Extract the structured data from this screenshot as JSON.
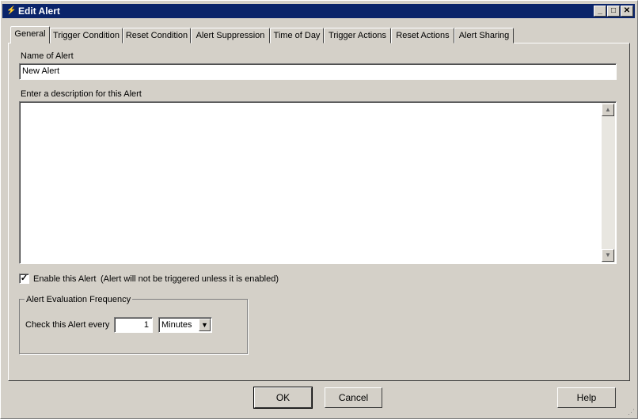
{
  "window": {
    "title": "Edit Alert",
    "controls": [
      "minimize",
      "maximize",
      "close"
    ]
  },
  "tabs": [
    {
      "label": "General",
      "active": true
    },
    {
      "label": "Trigger Condition"
    },
    {
      "label": "Reset Condition"
    },
    {
      "label": "Alert Suppression"
    },
    {
      "label": "Time of Day"
    },
    {
      "label": "Trigger Actions"
    },
    {
      "label": "Reset Actions"
    },
    {
      "label": "Alert Sharing"
    }
  ],
  "general": {
    "name_label": "Name of Alert",
    "name_value": "New Alert",
    "description_label": "Enter a description for this Alert",
    "description_value": "",
    "enable_label": "Enable this Alert",
    "enable_checked": true,
    "enable_note": "(Alert will not be triggered unless it is enabled)",
    "frequency_group": "Alert Evaluation Frequency",
    "check_label": "Check this Alert every",
    "check_value": "1",
    "check_unit": "Minutes"
  },
  "buttons": {
    "ok": "OK",
    "cancel": "Cancel",
    "help": "Help"
  }
}
